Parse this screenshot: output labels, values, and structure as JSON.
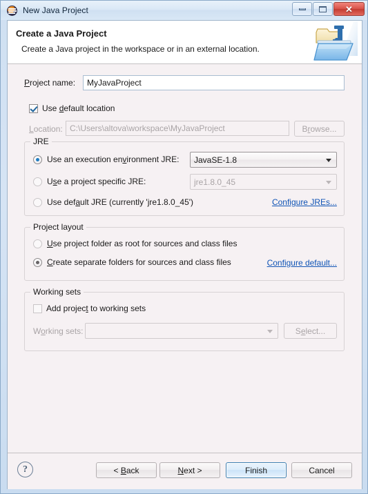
{
  "window": {
    "title": "New Java Project",
    "icon": "eclipse-logo-icon",
    "minimize_label": "",
    "maximize_label": "",
    "close_label": "✕"
  },
  "header": {
    "title": "Create a Java Project",
    "description": "Create a Java project in the workspace or in an external location.",
    "icon": "java-project-folder-icon"
  },
  "project": {
    "name_label": "Project name:",
    "name_value": "MyJavaProject",
    "use_default_location_label": "Use default location",
    "use_default_location_checked": true,
    "location_label": "Location:",
    "location_value": "C:\\Users\\altova\\workspace\\MyJavaProject",
    "browse_label": "Browse..."
  },
  "jre": {
    "group_title": "JRE",
    "option_execution_env": "Use an execution environment JRE:",
    "option_project_specific": "Use a project specific JRE:",
    "option_default": "Use default JRE (currently 'jre1.8.0_45')",
    "selected": "execution_env",
    "execution_env_value": "JavaSE-1.8",
    "project_specific_value": "jre1.8.0_45",
    "configure_link": "Configure JREs..."
  },
  "layout": {
    "group_title": "Project layout",
    "option_project_folder": "Use project folder as root for sources and class files",
    "option_separate_folders": "Create separate folders for sources and class files",
    "selected": "separate_folders",
    "configure_link": "Configure default..."
  },
  "working_sets": {
    "group_title": "Working sets",
    "add_label": "Add project to working sets",
    "add_checked": false,
    "sets_label": "Working sets:",
    "sets_value": "",
    "select_label": "Select..."
  },
  "footer": {
    "help_glyph": "?",
    "back_label": "< Back",
    "next_label": "Next >",
    "finish_label": "Finish",
    "cancel_label": "Cancel"
  },
  "colors": {
    "dialog_bg": "#f6f1f3",
    "header_bg": "#ffffff",
    "link": "#0f53b5",
    "accent_radio": "#1f7cc1",
    "default_button_border": "#3c7fb1",
    "close_button": "#d9534a"
  }
}
